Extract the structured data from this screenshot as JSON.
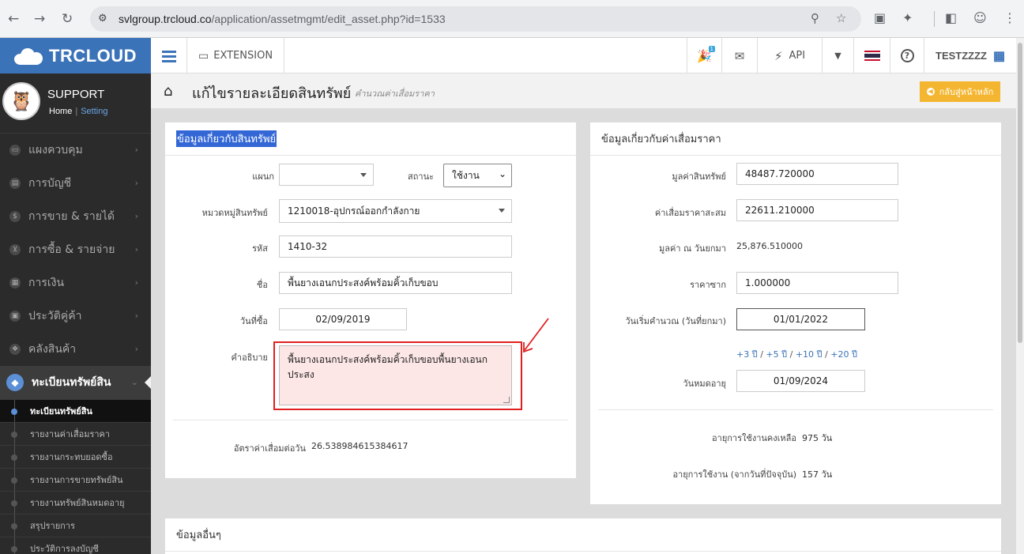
{
  "browser": {
    "url_host": "svlgroup.trcloud.co",
    "url_path": "/application/assetmgmt/edit_asset.php?id=1533"
  },
  "sidebar": {
    "brand": "TRCLOUD",
    "user": "SUPPORT",
    "home_link": "Home",
    "setting_link": "Setting",
    "items": [
      {
        "label": "แผงควบคุม",
        "icon": "monitor-icon"
      },
      {
        "label": "การบัญชี",
        "icon": "book-icon"
      },
      {
        "label": "การขาย & รายได้",
        "icon": "dollar-icon"
      },
      {
        "label": "การซื้อ & รายจ่าย",
        "icon": "cart-icon"
      },
      {
        "label": "การเงิน",
        "icon": "calendar-icon"
      },
      {
        "label": "ประวัติคู่ค้า",
        "icon": "contact-icon"
      },
      {
        "label": "คลังสินค้า",
        "icon": "boxes-icon"
      }
    ],
    "active_item": "ทะเบียนทรัพย์สิน",
    "sub_items": [
      "ทะเบียนทรัพย์สิน",
      "รายงานค่าเสื่อมราคา",
      "รายงานกระทบยอดซื้อ",
      "รายงานการขายทรัพย์สิน",
      "รายงานทรัพย์สินหมดอายุ",
      "สรุปรายการ",
      "ประวัติการลงบัญชี"
    ]
  },
  "topbar": {
    "extension": "EXTENSION",
    "badge": "1",
    "api": "API",
    "user": "TESTZZZZ"
  },
  "page": {
    "title": "แก้ไขรายละเอียดสินทรัพย์",
    "subtitle": "คำนวณค่าเสื่อมราคา",
    "back_button": "กลับสู่หน้าหลัก"
  },
  "asset_panel": {
    "heading": "ข้อมูลเกี่ยวกับสินทรัพย์",
    "dept_label": "แผนก",
    "dept_value": "",
    "status_label": "สถานะ",
    "status_value": "ใช้งาน",
    "category_label": "หมวดหมู่สินทรัพย์",
    "category_value": "1210018-อุปกรณ์ออกกำลังกาย",
    "code_label": "รหัส",
    "code_value": "1410-32",
    "name_label": "ชื่อ",
    "name_value": "พื้นยางเอนกประสงค์พร้อมคิ้วเก็บขอบ",
    "date_label": "วันที่ซื้อ",
    "date_value": "02/09/2019",
    "desc_label": "คำอธิบาย",
    "desc_value": "พื้นยางเอนกประสงค์พร้อมคิ้วเก็บขอบพื้นยางเอนกประสง",
    "rate_label": "อัตราค่าเสื่อมต่อวัน",
    "rate_value": "26.538984615384617"
  },
  "depr_panel": {
    "heading": "ข้อมูลเกี่ยวกับค่าเสื่อมราคา",
    "value_label": "มูลค่าสินทรัพย์",
    "value_value": "48487.720000",
    "accum_label": "ค่าเสื่อมราคาสะสม",
    "accum_value": "22611.210000",
    "bf_label": "มูลค่า ณ วันยกมา",
    "bf_value": "25,876.510000",
    "salvage_label": "ราคาซาก",
    "salvage_value": "1.000000",
    "start_label": "วันเริ่มคำนวณ (วันที่ยกมา)",
    "start_value": "01/01/2022",
    "year_links": [
      "+3 ปี",
      "+5 ปี",
      "+10 ปี",
      "+20 ปี"
    ],
    "expire_label": "วันหมดอายุ",
    "expire_value": "01/09/2024",
    "remain_label": "อายุการใช้งานคงเหลือ",
    "remain_value": "975 วัน",
    "used_label": "อายุการใช้งาน (จากวันที่ปัจจุบัน)",
    "used_value": "157 วัน"
  },
  "other_panel": {
    "heading": "ข้อมูลอื่นๆ"
  },
  "colors": {
    "brand_blue": "#3b73b9",
    "highlight_red": "#e02020",
    "button_orange": "#f4b630"
  }
}
